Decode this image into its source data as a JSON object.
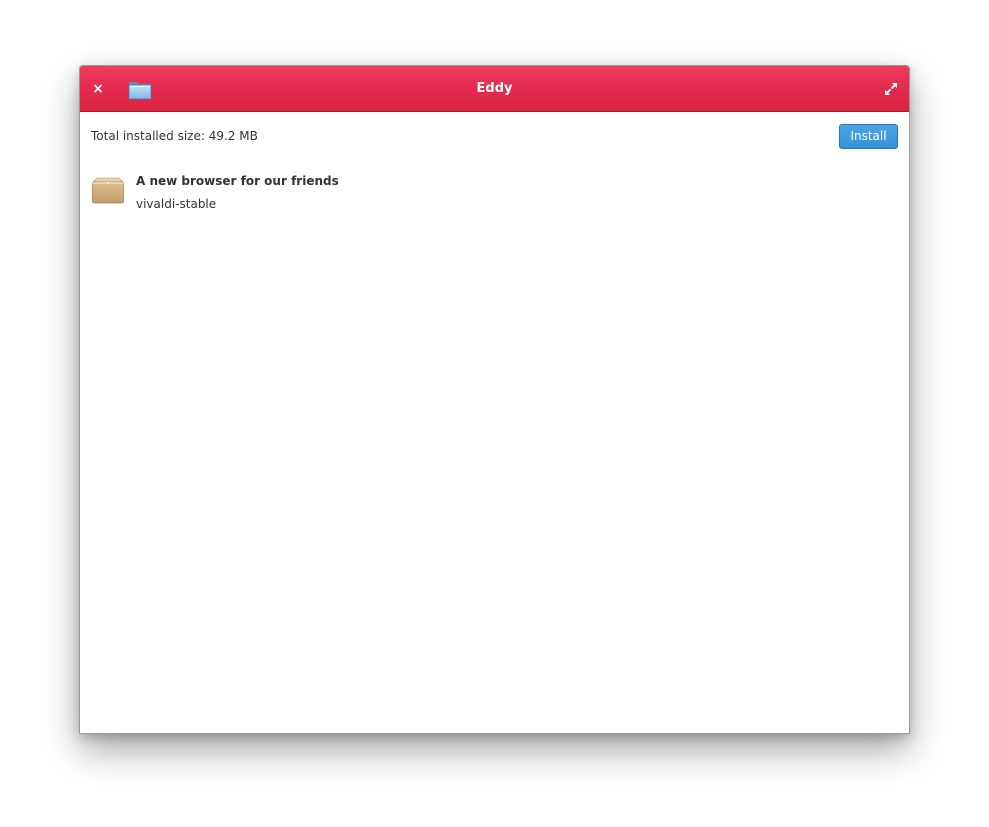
{
  "window": {
    "title": "Eddy",
    "close_glyph": "×",
    "accent_color": "#e22b4c"
  },
  "summary": {
    "total_size_text": "Total installed size: 49.2 MB"
  },
  "actions": {
    "install_label": "Install",
    "install_color": "#3393d8"
  },
  "packages": [
    {
      "name": "A new browser for our friends",
      "id": "vivaldi-stable",
      "icon": "package-box-icon"
    }
  ],
  "icons": {
    "close": "close-icon",
    "open_folder": "folder-icon",
    "maximize": "maximize-icon"
  }
}
